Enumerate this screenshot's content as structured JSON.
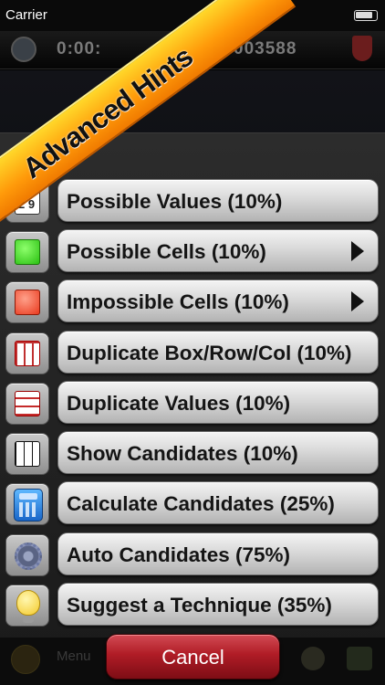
{
  "status_bar": {
    "carrier": "Carrier"
  },
  "game_bar": {
    "timer": "0:00:",
    "score": "003588"
  },
  "banner": {
    "label": "Advanced Hints"
  },
  "hints": [
    {
      "label": "Possible Values (10%)",
      "icon": "number-grid-icon",
      "has_arrow": false
    },
    {
      "label": "Possible Cells (10%)",
      "icon": "green-square-icon",
      "has_arrow": true
    },
    {
      "label": "Impossible Cells (10%)",
      "icon": "red-square-icon",
      "has_arrow": true
    },
    {
      "label": "Duplicate Box/Row/Col (10%)",
      "icon": "red-grid-icon",
      "has_arrow": false
    },
    {
      "label": "Duplicate Values (10%)",
      "icon": "duplicate-values-icon",
      "has_arrow": false
    },
    {
      "label": "Show Candidates (10%)",
      "icon": "candidates-grid-icon",
      "has_arrow": false
    },
    {
      "label": "Calculate Candidates (25%)",
      "icon": "calculator-icon",
      "has_arrow": false
    },
    {
      "label": "Auto Candidates (75%)",
      "icon": "gear-pencil-icon",
      "has_arrow": false
    },
    {
      "label": "Suggest a Technique (35%)",
      "icon": "lightbulb-icon",
      "has_arrow": false
    }
  ],
  "icon_values": {
    "possible_values": "2 9"
  },
  "toolbar": {
    "menu_label": "Menu"
  },
  "cancel": {
    "label": "Cancel"
  },
  "colors": {
    "banner": "#ff9a0a",
    "cancel": "#b01c26",
    "button_face": "#d9d9d9"
  }
}
